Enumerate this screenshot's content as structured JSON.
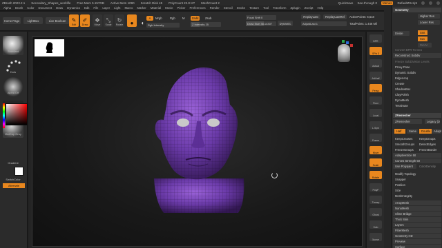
{
  "titlebar": {
    "app": "ZBrush 2023.2.1",
    "doc": "Secondary_Shapes_worklife",
    "free_mem": "Free Mem 5.157GB",
    "active_mem": "Active Mem 1090",
    "scratch": "Scratch Disk 45",
    "polycount": "PolyCount 22.8 KP",
    "meshcount": "MeshCount 2",
    "quicksave": "QuickSave",
    "seethrough": "See-through 0",
    "menus": "Menus",
    "script": "DefaultZScript"
  },
  "menubar": [
    "Alpha",
    "Brush",
    "Color",
    "Document",
    "Draw",
    "Dynamics",
    "Edit",
    "File",
    "Layer",
    "Light",
    "Macro",
    "Marker",
    "Material",
    "Movie",
    "Picker",
    "Preferences",
    "Render",
    "Stencil",
    "Stroke",
    "Texture",
    "Tool",
    "Transform",
    "Zplugin",
    "Zscript",
    "Help"
  ],
  "toolbar": {
    "home_page": "Home Page",
    "lightbox": "LightBox",
    "live_boolean": "Live Boolean",
    "edit": "Edit",
    "draw": "Draw",
    "move": "Move",
    "scale": "Scale",
    "rotate": "Rotate",
    "mrgb": "Mrgb",
    "rgb": "Rgb",
    "m": "M",
    "zadd": "Zadd",
    "zsub": "Zsub",
    "z_intensity": "Z Intensity 25",
    "rgb_intensity": "Rgb Intensity",
    "focal_shift": "Focal Shift 0",
    "draw_size": "Draw Size 38.14307",
    "dynamic": "Dynamic",
    "replay_last": "ReplayLast",
    "replay_last_rel": "ReplayLastRel",
    "active_points": "ActivePoints: 6,518",
    "adjust_last": "AdjustLast 1",
    "total_points": "TotalPoints: 1.446 Mil"
  },
  "left_shelf": {
    "standard": "Standard",
    "dots": "Dots",
    "alpha_off": "Alpha Off",
    "texture_off": "Texture Off",
    "matcap": "MatCap Gray",
    "gradient": "Gradient",
    "switch_color": "SwitchColor",
    "alternate": "Alternate"
  },
  "right_rail": [
    "BPR",
    "SPix 3",
    "Actual",
    "AAHalf",
    "Persp",
    "Floor",
    "Local",
    "L.Sym",
    "Frame",
    "Move",
    "Scale",
    "Rotate",
    "PolyF",
    "Transp",
    "Ghost",
    "Solo",
    "Xpose"
  ],
  "tray": {
    "geometry": "Geometry",
    "higher_res": "Higher Res",
    "lower_res": "Lower Res",
    "divide": "Divide",
    "smt": "Smt",
    "suv": "Suv",
    "reuv": "ReUV",
    "reconstruct": "Reconstruct Subdiv",
    "convert_bpr": "Convert BPR To Geo",
    "freeze_subdiv": "Freeze SubDivision Levels",
    "del_lower": "Del Lower",
    "del_higher": "Del Higher",
    "items_a": [
      "Proxy Pose",
      "Dynamic Subdiv",
      "EdgeLoop",
      "Crease",
      "ShadowBox",
      "ClayPolish",
      "DynaMesh",
      "Tessimate"
    ],
    "zremesher": "ZRemesher",
    "zremesher_btn": "ZRemesher",
    "legacy": "Legacy (2018)",
    "freeze_border": "FreezeBorder",
    "freeze_groups": "FreezeGroups",
    "smooth_groups": "SmoothGroups",
    "keep_groups": "KeepGroups",
    "keep_creases": "KeepCreases",
    "detect_edges": "DetectEdges",
    "target_poly": "Target Polygons Count 5",
    "half": "Half",
    "same": "Same",
    "double": "Double",
    "adapt": "Adapt",
    "adaptive_size": "AdaptiveSize 50",
    "curves_strength": "Curves Strength 50",
    "use_polypaint": "Use Polypaint",
    "color_density": "ColorDensity",
    "items_b": [
      "Modify Topology",
      "Snapper",
      "Position",
      "Size",
      "MeshIntegrity"
    ],
    "items_c": [
      "ArrayMesh",
      "NanoMesh",
      "Slime Bridge",
      "Thick Skin",
      "Layers",
      "FiberMesh",
      "Geometry HD",
      "Preview",
      "Surface"
    ]
  }
}
